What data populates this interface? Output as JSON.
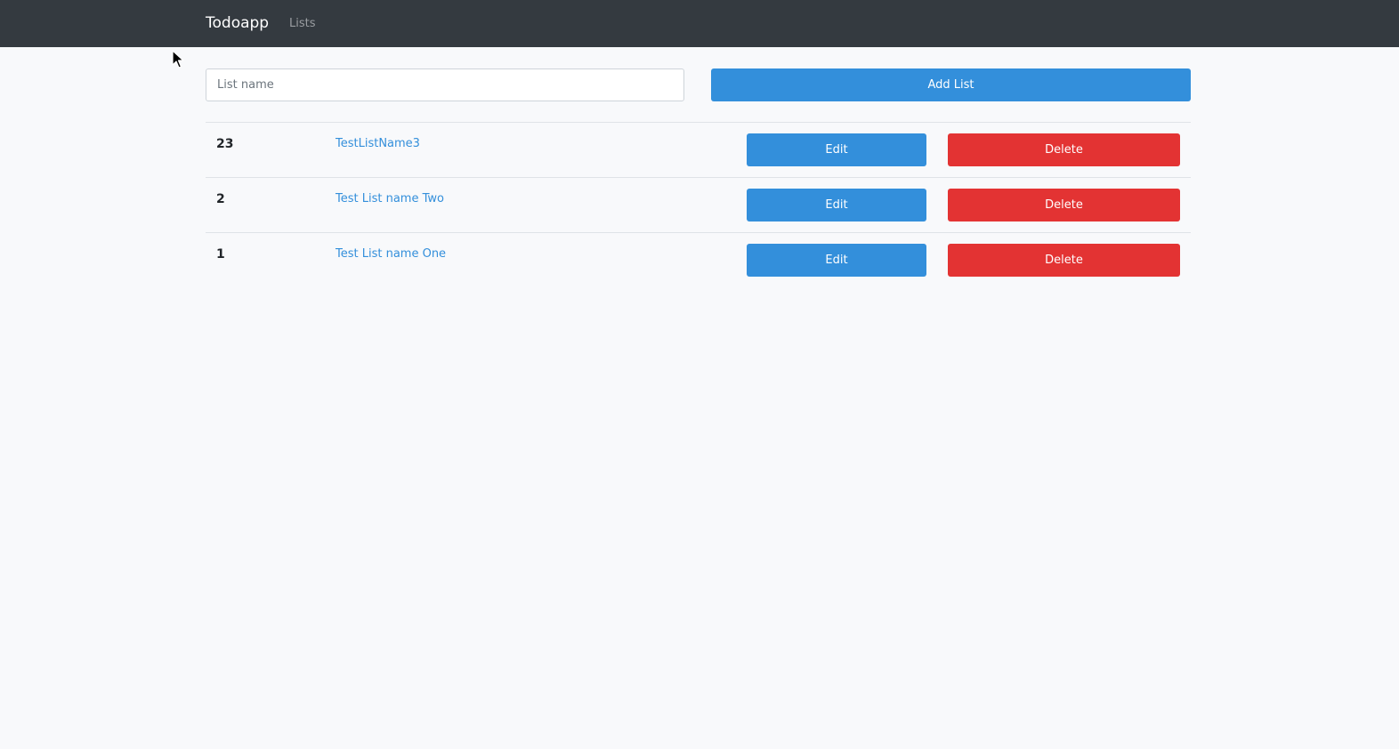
{
  "navbar": {
    "brand": "Todoapp",
    "links": [
      {
        "label": "Lists"
      }
    ]
  },
  "form": {
    "list_name_placeholder": "List name",
    "list_name_value": "",
    "add_button_label": "Add List"
  },
  "lists": [
    {
      "id": "23",
      "name": "TestListName3",
      "edit_label": "Edit",
      "delete_label": "Delete"
    },
    {
      "id": "2",
      "name": "Test List name Two",
      "edit_label": "Edit",
      "delete_label": "Delete"
    },
    {
      "id": "1",
      "name": "Test List name One",
      "edit_label": "Edit",
      "delete_label": "Delete"
    }
  ],
  "colors": {
    "navbar_bg": "#343a40",
    "primary": "#338fdb",
    "danger": "#e33333",
    "page_bg": "#f8f9fb"
  },
  "icons": {
    "cursor": "mouse-pointer-icon"
  }
}
